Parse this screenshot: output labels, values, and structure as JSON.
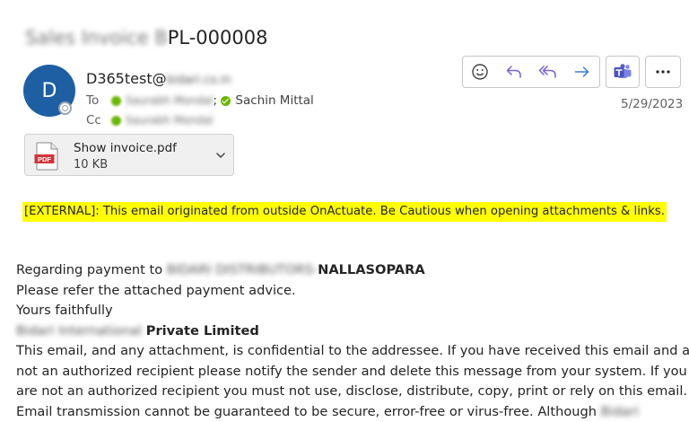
{
  "email": {
    "subject_blurred": "Sales Invoice B",
    "subject_visible": "PL-000008",
    "avatar_initial": "D",
    "sender_visible": "D365test@",
    "sender_blurred": "bidari.co.in",
    "to_label": "To",
    "to_recipient1_blurred": "Saurabh Mondal",
    "to_separator": ";",
    "to_recipient2": "Sachin Mittal",
    "cc_label": "Cc",
    "cc_recipient_blurred": "Saurabh Mondal",
    "date": "5/29/2023",
    "attachment": {
      "name": "Show invoice.pdf",
      "size": "10 KB",
      "type_label": "PDF"
    },
    "banner": "[EXTERNAL]: This email originated from outside OnActuate. Be Cautious when opening attachments & links.",
    "body": {
      "line1_prefix": "Regarding payment to ",
      "line1_blurred": "BIDARI DISTRIBUTORS-",
      "line1_visible": "NALLASOPARA",
      "line2": "Please refer the attached payment advice.",
      "line3": "Yours faithfully",
      "line4_blurred": "Bidari International",
      "line4_visible": "Private Limited",
      "line5": "This email, and any attachment, is confidential to the addressee. If you have received this email and are",
      "line6": "not an authorized recipient please notify the sender and delete this message from your system. If you",
      "line7": "are not an authorized recipient you must not use, disclose, distribute, copy, print or rely on this email.",
      "line8": "Email transmission cannot be guaranteed to be secure, error-free or virus-free. Although",
      "line8_blurred": "Bidari"
    }
  },
  "colors": {
    "avatar": "#1e5fa3",
    "accent": "#7b61d4",
    "banner": "#ffff00",
    "teams": "#5b5fc7"
  }
}
